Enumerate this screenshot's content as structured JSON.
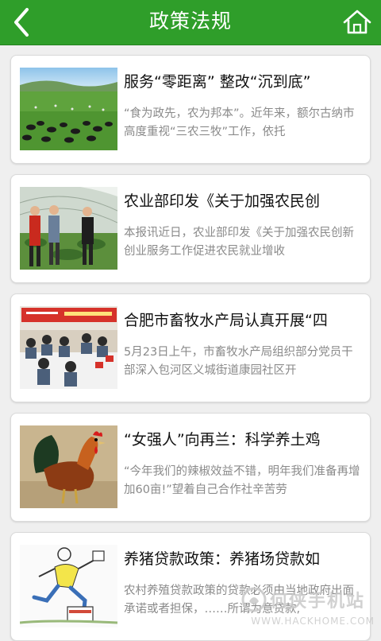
{
  "header": {
    "title": "政策法规",
    "back_icon": "back-arrow-icon",
    "home_icon": "home-icon",
    "color": "#2f9e2a"
  },
  "articles": [
    {
      "title": "服务“零距离” 整改“沉到底”",
      "summary": "“食为政先，农为邦本”。近年来，额尔古纳市高度重视“三农三牧”工作，依托",
      "image": "grassland-cattle-photo"
    },
    {
      "title": "农业部印发《关于加强农民创",
      "summary": "本报讯近日，农业部印发《关于加强农民创新创业服务工作促进农民就业增收",
      "image": "greenhouse-officials-photo"
    },
    {
      "title": "合肥市畜牧水产局认真开展“四",
      "summary": "5月23日上午，市畜牧水产局组织部分党员干部深入包河区义城街道康园社区开",
      "image": "meeting-room-photo"
    },
    {
      "title": "“女强人”向再兰：科学养土鸡",
      "summary": "“今年我们的辣椒效益不错，明年我们准备再增加60亩!”望着自己合作社辛苦劳",
      "image": "rooster-photo"
    },
    {
      "title": "养猪贷款政策：养猪场贷款如",
      "summary": "农村养殖贷款政策的贷款必须由当地政府出面承诺或者担保，……所谓为意贷款,",
      "image": "cartoon-runner-illustration"
    }
  ],
  "watermark": {
    "name": "何侠手机站",
    "site": "WWW.HACKHOME.COM"
  }
}
